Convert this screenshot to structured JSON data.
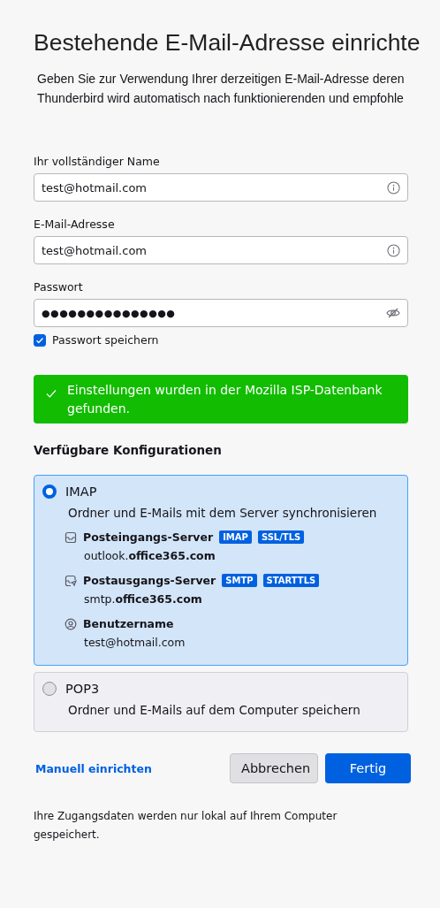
{
  "title": "Bestehende E-Mail-Adresse einrichte",
  "intro_lines": [
    "Geben Sie zur Verwendung Ihrer derzeitigen E-Mail-Adresse deren",
    "Thunderbird wird automatisch nach funktionierenden und empfohle"
  ],
  "fields": [
    {
      "label": "Ihr vollständiger Name",
      "value": "test@hotmail.com",
      "kind": "info"
    },
    {
      "label": "E-Mail-Adresse",
      "value": "test@hotmail.com",
      "kind": "info"
    },
    {
      "label": "Passwort",
      "value": "●●●●●●●●●●●●●●●",
      "kind": "password"
    }
  ],
  "remember_password": {
    "label": "Passwort speichern",
    "checked": true
  },
  "notice": {
    "text": "Einstellungen wurden in der Mozilla ISP-Datenbank gefunden."
  },
  "configurations": {
    "heading": "Verfügbare Konfigurationen",
    "options": [
      {
        "name": "IMAP",
        "description": "Ordner und E-Mails mit dem Server synchronisieren",
        "selected": true,
        "details": [
          {
            "kind": "incoming",
            "label": "Posteingangs-Server",
            "badges": [
              "IMAP",
              "SSL/TLS"
            ],
            "value": "outlook.**office365.com**"
          },
          {
            "kind": "outgoing",
            "label": "Postausgangs-Server",
            "badges": [
              "SMTP",
              "STARTTLS"
            ],
            "value": "smtp.**office365.com**"
          },
          {
            "kind": "user",
            "label": "Benutzername",
            "value": "test@hotmail.com"
          }
        ]
      },
      {
        "name": "POP3",
        "description": "Ordner und E-Mails auf dem Computer speichern",
        "selected": false
      }
    ]
  },
  "manual_link": "Manuell einrichten",
  "buttons": [
    {
      "label": "Abbrechen",
      "kind": "secondary"
    },
    {
      "label": "Fertig",
      "kind": "primary"
    }
  ],
  "footer": "Ihre Zugangsdaten werden nur lokal auf Ihrem Computer gespeichert."
}
